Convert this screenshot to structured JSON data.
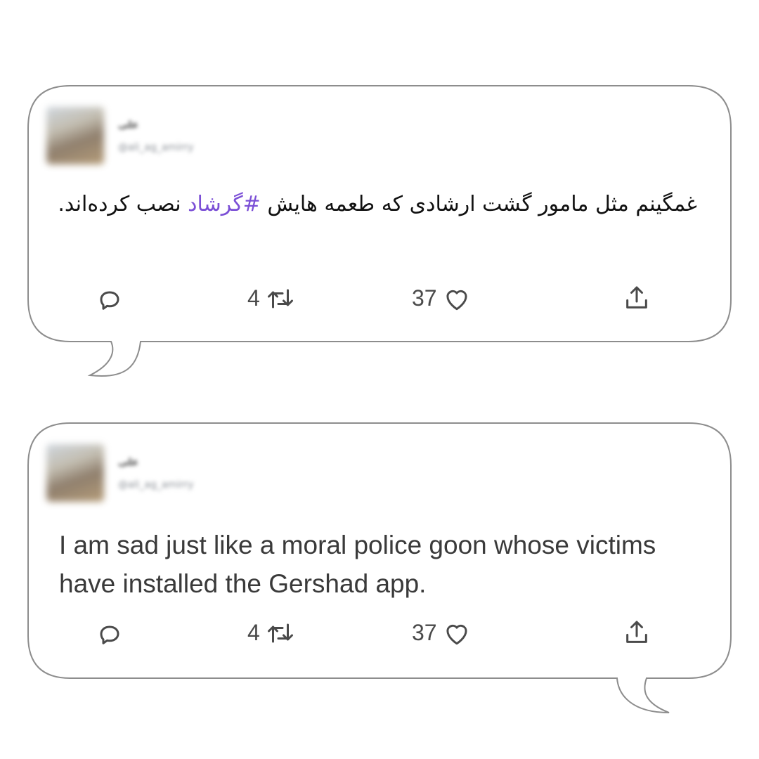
{
  "tweets": [
    {
      "user_name": "علی",
      "user_handle": "@ali_ag_amirry",
      "text_before": "غمگینم مثل مامور گشت ارشادی که طعمه هایش ",
      "hashtag": "#گرشاد",
      "text_after": " نصب کرده‌اند.",
      "retweets": "4",
      "likes": "37",
      "icons": [
        "reply-icon",
        "retweet-icon",
        "like-icon",
        "share-icon"
      ]
    },
    {
      "user_name": "علی",
      "user_handle": "@ali_ag_amirry",
      "text": "I am sad just like a moral police goon whose victims have installed the Gershad app.",
      "retweets": "4",
      "likes": "37",
      "icons": [
        "reply-icon",
        "retweet-icon",
        "like-icon",
        "share-icon"
      ]
    }
  ],
  "colors": {
    "hashtag": "#7b4fd6",
    "bubble_stroke": "#8d8d8d",
    "text": "#111111",
    "icon": "#4a4a4a"
  }
}
